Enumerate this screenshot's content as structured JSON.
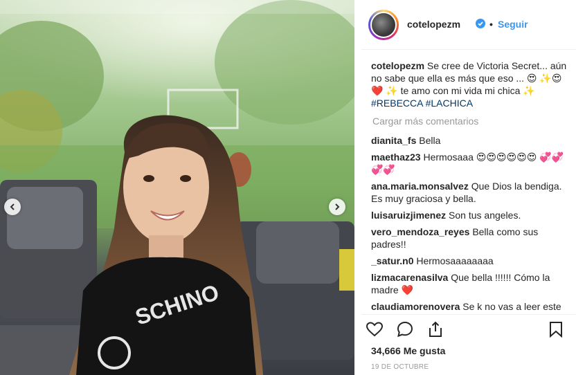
{
  "post": {
    "username": "cotelopezm",
    "follow_label": "Seguir",
    "separator": "•",
    "caption_parts": {
      "text1": "Se cree de Victoria Secret... aún no sabe que ella es más que eso ... 😍 ✨😍",
      "heart": "❤️",
      "text2": "✨ te amo con mi vida mi chica ✨",
      "hashtag1": "#REBECCA",
      "hashtag2": "#LACHICA"
    },
    "load_more_label": "Cargar más comentarios",
    "comments": [
      {
        "user": "dianita_fs",
        "text": "Bella"
      },
      {
        "user": "maethaz23",
        "text": "Hermosaaa 😍😍😍😍😍😍 💞💞💞💞"
      },
      {
        "user": "ana.maria.monsalvez",
        "text": "Que Dios la bendiga. Es muy graciosa y bella."
      },
      {
        "user": "luisaruizjimenez",
        "text": "Son tus angeles."
      },
      {
        "user": "vero_mendoza_reyes",
        "text": "Bella como sus padres!!"
      },
      {
        "user": "_satur.n0",
        "text": "Hermosaaaaaaaa"
      },
      {
        "user": "lizmacarenasilva",
        "text": "Que bella !!!!!! Cómo la madre",
        "heart": "❤️"
      },
      {
        "user": "claudiamorenovera",
        "text": "Se k no vas a leer este"
      }
    ],
    "likes_label": "34,666 Me gusta",
    "date_label": "19 DE OCTUBRE"
  },
  "icons": {
    "like": "heart-outline-icon",
    "comment": "speech-bubble-icon",
    "share": "share-icon",
    "save": "bookmark-icon",
    "verified": "verified-badge-icon",
    "prev": "chevron-left-icon",
    "next": "chevron-right-icon"
  },
  "colors": {
    "accent": "#3897f0",
    "hashtag": "#003569",
    "verified": "#3897f0",
    "muted": "#999999",
    "heart": "#ed1c24"
  }
}
